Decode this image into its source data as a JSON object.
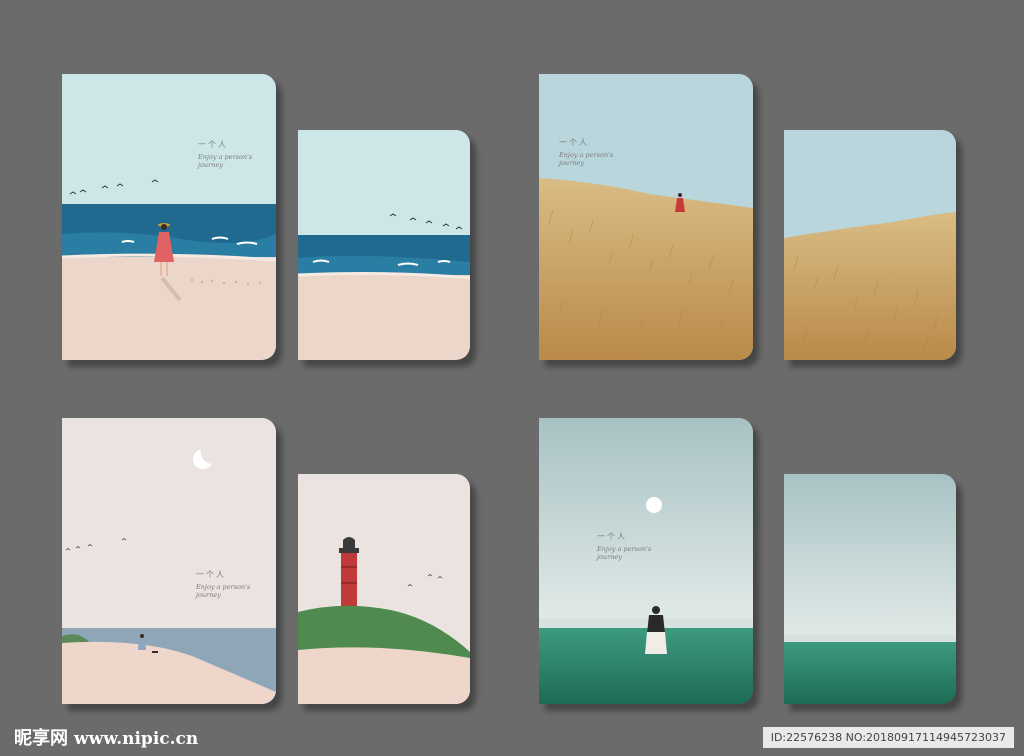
{
  "caption": {
    "title_cn": "一个人",
    "subtitle_en_line1": "Enjoy a person's",
    "subtitle_en_line2": "journey"
  },
  "watermark": {
    "site_name": "昵享网",
    "site_url": "www.nipic.cn",
    "image_info": "ID:22576238 NO:20180917114945723037"
  },
  "colors": {
    "background": "#6b6b6b",
    "sky_beach": "#cde6e8",
    "sea": "#1f6a8e",
    "sand": "#ecd6c9",
    "wheat": "#c8a061",
    "grass_green": "#2f8a72",
    "lighthouse_red": "#c0393b"
  },
  "icons": [
    "seagull-icon",
    "moon-icon",
    "sun-icon",
    "lighthouse-icon",
    "person-icon"
  ]
}
